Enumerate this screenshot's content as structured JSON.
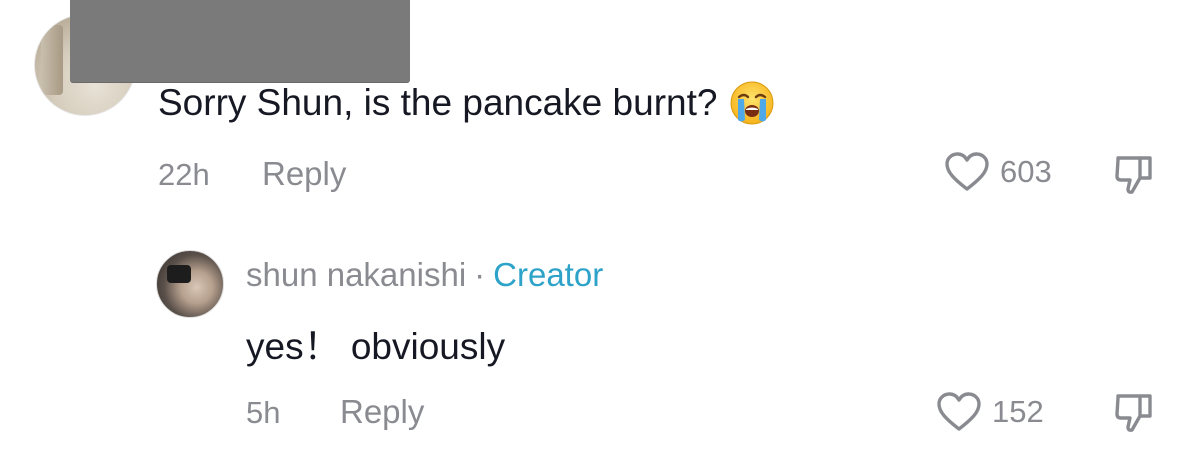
{
  "comments": [
    {
      "text": "Sorry Shun, is the pancake burnt?",
      "emoji": "loudly-crying-face",
      "time": "22h",
      "reply_label": "Reply",
      "likes": "603"
    }
  ],
  "reply": {
    "username": "shun nakanishi",
    "separator": "·",
    "badge": "Creator",
    "text": "yes！ obviously",
    "time": "5h",
    "reply_label": "Reply",
    "likes": "152"
  },
  "colors": {
    "text": "#161823",
    "meta": "#8a8b91",
    "creator_badge": "#2ea3c9",
    "redaction": "#7a7a7a"
  },
  "icons": {
    "like": "heart-outline-icon",
    "dislike": "thumbs-down-outline-icon"
  }
}
